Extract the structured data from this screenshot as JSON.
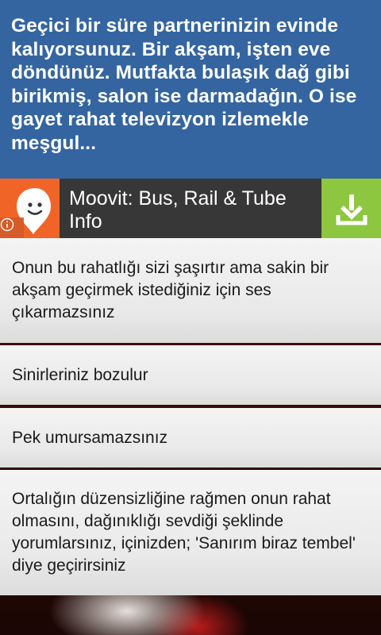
{
  "question": {
    "text": "Geçici bir süre partnerinizin evinde kalıyorsunuz. Bir akşam, işten eve döndünüz. Mutfakta bulaşık dağ gibi birikmiş, salon ise darmadağın. O ise gayet rahat televizyon izlemekle meşgul..."
  },
  "ad": {
    "title": "Moovit: Bus, Rail & Tube Info",
    "logo_icon": "moovit-logo-icon",
    "info_icon": "info-icon",
    "download_icon": "download-icon",
    "colors": {
      "logo_bg": "#f06428",
      "bar_bg": "#373737",
      "download_bg": "#8dc63f"
    }
  },
  "answers": [
    {
      "label": "Onun bu rahatlığı sizi şaşırtır ama sakin bir akşam geçirmek istediğiniz için ses çıkarmazsınız"
    },
    {
      "label": "Sinirleriniz bozulur"
    },
    {
      "label": "Pek umursamazsınız"
    },
    {
      "label": "Ortalığın düzensizliğine rağmen onun rahat olmasını, dağınıklığı sevdiği şeklinde yorumlarsınız, içinizden; 'Sanırım biraz tembel' diye geçirirsiniz"
    }
  ],
  "colors": {
    "question_bg": "#3465a0"
  }
}
